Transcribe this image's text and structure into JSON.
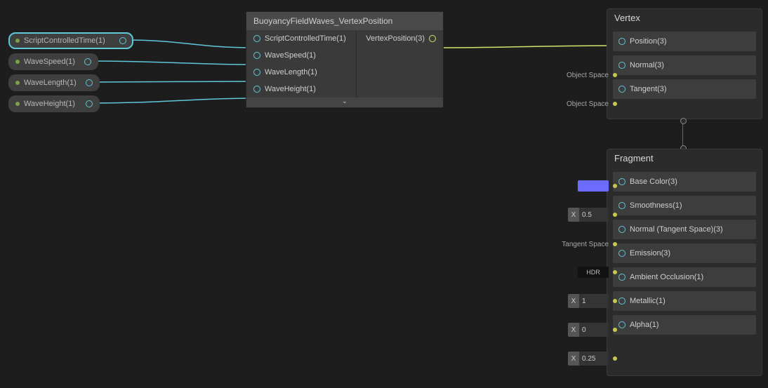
{
  "params": [
    {
      "label": "ScriptControlledTime(1)"
    },
    {
      "label": "WaveSpeed(1)"
    },
    {
      "label": "WaveLength(1)"
    },
    {
      "label": "WaveHeight(1)"
    }
  ],
  "node": {
    "title": "BuoyancyFieldWaves_VertexPosition",
    "inputs": [
      "ScriptControlledTime(1)",
      "WaveSpeed(1)",
      "WaveLength(1)",
      "WaveHeight(1)"
    ],
    "outputs": [
      "VertexPosition(3)"
    ],
    "expand": "⌄"
  },
  "vertex": {
    "title": "Vertex",
    "slots": [
      "Position(3)",
      "Normal(3)",
      "Tangent(3)"
    ],
    "labels": [
      "",
      "Object Space",
      "Object Space"
    ]
  },
  "fragment": {
    "title": "Fragment",
    "rows": [
      {
        "kind": "color",
        "color": "#6b6bff",
        "slot": "Base Color(3)"
      },
      {
        "kind": "x",
        "x": "X",
        "val": "0.5",
        "slot": "Smoothness(1)"
      },
      {
        "kind": "label",
        "label": "Tangent Space",
        "slot": "Normal (Tangent Space)(3)"
      },
      {
        "kind": "hdr",
        "label": "HDR",
        "slot": "Emission(3)"
      },
      {
        "kind": "x",
        "x": "X",
        "val": "1",
        "slot": "Ambient Occlusion(1)"
      },
      {
        "kind": "x",
        "x": "X",
        "val": "0",
        "slot": "Metallic(1)"
      },
      {
        "kind": "x",
        "x": "X",
        "val": "0.25",
        "slot": "Alpha(1)"
      }
    ]
  }
}
